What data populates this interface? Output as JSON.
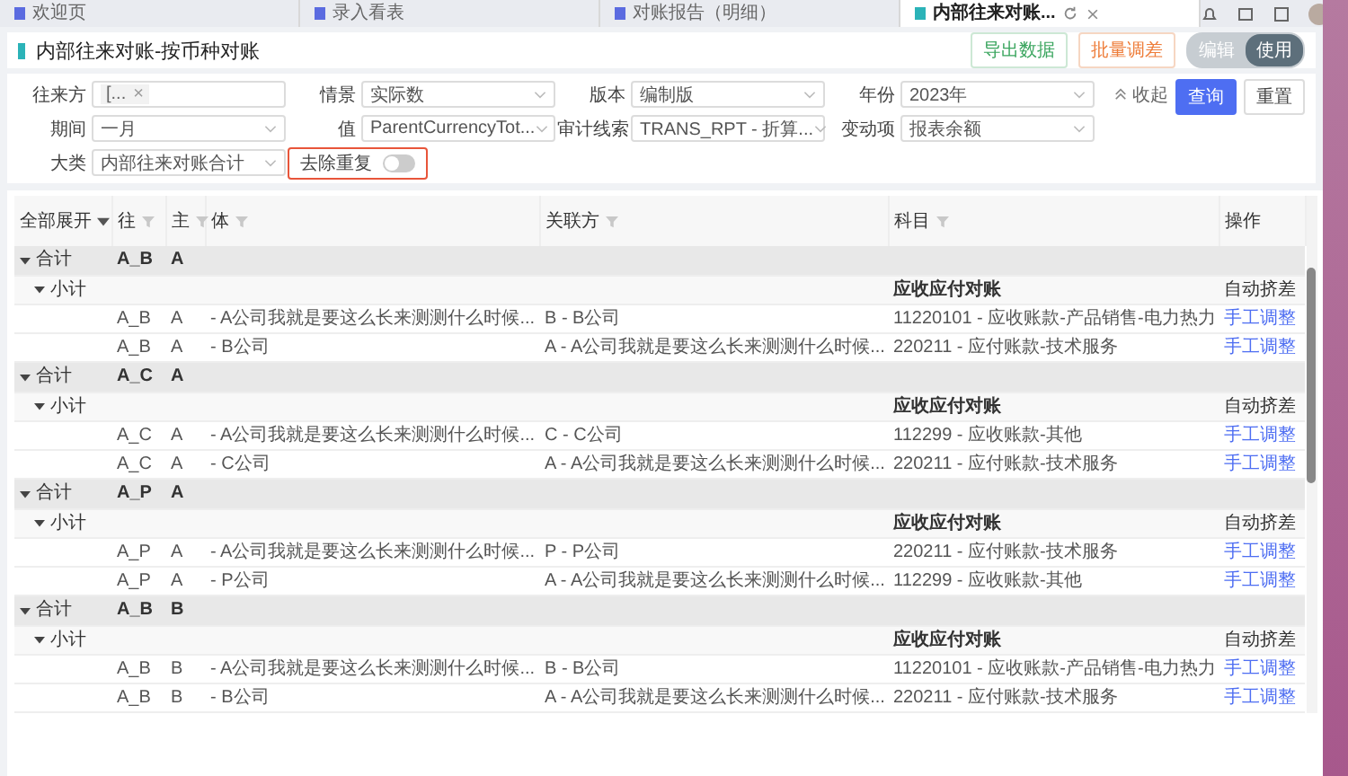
{
  "tabs": [
    {
      "label": "欢迎页",
      "selected": false
    },
    {
      "label": "录入看表",
      "selected": false
    },
    {
      "label": "对账报告（明细）",
      "selected": false
    },
    {
      "label": "内部往来对账...",
      "selected": true
    }
  ],
  "page": {
    "title": "内部往来对账-按币种对账",
    "buttons": [
      {
        "label": "导出数据",
        "kind": "export"
      },
      {
        "label": "批量调差",
        "kind": "adjust"
      }
    ],
    "mode_toggle": [
      {
        "label": "编辑",
        "selected": false
      },
      {
        "label": "使用",
        "selected": true
      }
    ]
  },
  "filters": [
    {
      "label": "往来方",
      "kind": "tag",
      "value": "[...",
      "remove": "×"
    },
    {
      "label": "情景",
      "kind": "select",
      "value": "实际数"
    },
    {
      "label": "版本",
      "kind": "select",
      "value": "编制版"
    },
    {
      "label": "年份",
      "kind": "select",
      "value": "2023年"
    },
    {
      "label": "期间",
      "kind": "select",
      "value": "一月"
    },
    {
      "label": "值",
      "kind": "select",
      "value": "ParentCurrencyTot..."
    },
    {
      "label": "审计线索",
      "kind": "select",
      "value": "TRANS_RPT - 折算..."
    },
    {
      "label": "变动项",
      "kind": "select",
      "value": "报表余额"
    },
    {
      "label": "大类",
      "kind": "select",
      "value": "内部往来对账合计"
    }
  ],
  "dedupe": {
    "label": "去除重复",
    "on": false,
    "highlighted": true
  },
  "actions": {
    "collapse": "收起",
    "query": "查询",
    "reset": "重置"
  },
  "table": {
    "columns": [
      {
        "label": "全部展开",
        "kind": "expand"
      },
      {
        "label": "往",
        "kind": "filter"
      },
      {
        "label": "主",
        "kind": "filter"
      },
      {
        "label": "体",
        "kind": "filter"
      },
      {
        "label": "关联方",
        "kind": "filter"
      },
      {
        "label": "科目",
        "kind": "filter"
      },
      {
        "label": "操作",
        "kind": "plain"
      }
    ],
    "groups": [
      {
        "label": "合计",
        "expanded": true,
        "wang": "A_B",
        "zhu": "A",
        "subtotal": {
          "label": "小计",
          "expanded": true,
          "subject": "应收应付对账",
          "operation": "自动挤差"
        },
        "rows": [
          {
            "wang": "A_B",
            "zhu": "A",
            "entity": "- A公司我就是要这么长来测测什么时候...",
            "related": "B - B公司",
            "subject": "11220101 - 应收账款-产品销售-电力热力",
            "action": "手工调整"
          },
          {
            "wang": "A_B",
            "zhu": "A",
            "entity": "- B公司",
            "related": "A - A公司我就是要这么长来测测什么时候...",
            "subject": "220211 - 应付账款-技术服务",
            "action": "手工调整"
          }
        ]
      },
      {
        "label": "合计",
        "expanded": true,
        "wang": "A_C",
        "zhu": "A",
        "subtotal": {
          "label": "小计",
          "expanded": true,
          "subject": "应收应付对账",
          "operation": "自动挤差"
        },
        "rows": [
          {
            "wang": "A_C",
            "zhu": "A",
            "entity": "- A公司我就是要这么长来测测什么时候...",
            "related": "C - C公司",
            "subject": "112299 - 应收账款-其他",
            "action": "手工调整"
          },
          {
            "wang": "A_C",
            "zhu": "A",
            "entity": "- C公司",
            "related": "A - A公司我就是要这么长来测测什么时候...",
            "subject": "220211 - 应付账款-技术服务",
            "action": "手工调整"
          }
        ]
      },
      {
        "label": "合计",
        "expanded": true,
        "wang": "A_P",
        "zhu": "A",
        "subtotal": {
          "label": "小计",
          "expanded": true,
          "subject": "应收应付对账",
          "operation": "自动挤差"
        },
        "rows": [
          {
            "wang": "A_P",
            "zhu": "A",
            "entity": "- A公司我就是要这么长来测测什么时候...",
            "related": "P - P公司",
            "subject": "220211 - 应付账款-技术服务",
            "action": "手工调整"
          },
          {
            "wang": "A_P",
            "zhu": "A",
            "entity": "- P公司",
            "related": "A - A公司我就是要这么长来测测什么时候...",
            "subject": "112299 - 应收账款-其他",
            "action": "手工调整"
          }
        ]
      },
      {
        "label": "合计",
        "expanded": true,
        "wang": "A_B",
        "zhu": "B",
        "subtotal": {
          "label": "小计",
          "expanded": true,
          "subject": "应收应付对账",
          "operation": "自动挤差"
        },
        "rows": [
          {
            "wang": "A_B",
            "zhu": "B",
            "entity": "- A公司我就是要这么长来测测什么时候...",
            "related": "B - B公司",
            "subject": "11220101 - 应收账款-产品销售-电力热力",
            "action": "手工调整"
          },
          {
            "wang": "A_B",
            "zhu": "B",
            "entity": "- B公司",
            "related": "A - A公司我就是要这么长来测测什么时候...",
            "subject": "220211 - 应付账款-技术服务",
            "action": "手工调整"
          }
        ]
      }
    ]
  }
}
